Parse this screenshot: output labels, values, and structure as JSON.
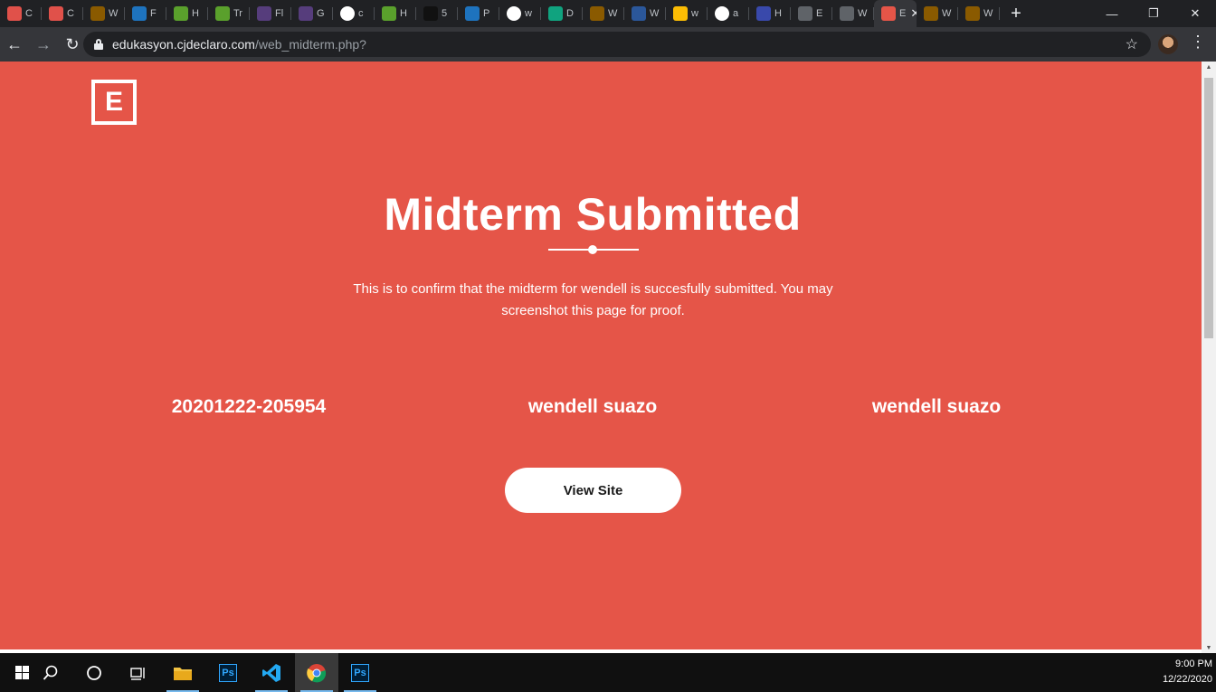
{
  "browser": {
    "tabs": [
      {
        "icon": "opera-tab-icon",
        "label": "C",
        "color": "#e0514a"
      },
      {
        "icon": "opera-tab-icon",
        "label": "C",
        "color": "#e0514a"
      },
      {
        "icon": "w-tab-icon",
        "label": "W",
        "color": "#8a5a00"
      },
      {
        "icon": "flag-tab-icon",
        "label": "F",
        "color": "#1e73be"
      },
      {
        "icon": "wave-tab-icon",
        "label": "H",
        "color": "#5aa02c"
      },
      {
        "icon": "wave-tab-icon",
        "label": "Tr",
        "color": "#5aa02c"
      },
      {
        "icon": "bootstrap-tab-icon",
        "label": "Fl",
        "color": "#563d7c"
      },
      {
        "icon": "bootstrap-tab-icon",
        "label": "G",
        "color": "#563d7c"
      },
      {
        "icon": "google-tab-icon",
        "label": "c",
        "color": "#ffffff"
      },
      {
        "icon": "wave-tab-icon",
        "label": "H",
        "color": "#5aa02c"
      },
      {
        "icon": "pixel-tab-icon",
        "label": "5",
        "color": "#111111"
      },
      {
        "icon": "flag-tab-icon",
        "label": "P",
        "color": "#1e73be"
      },
      {
        "icon": "github-tab-icon",
        "label": "w",
        "color": "#ffffff"
      },
      {
        "icon": "diamond-tab-icon",
        "label": "D",
        "color": "#10a37f"
      },
      {
        "icon": "w-tab-icon",
        "label": "W",
        "color": "#8a5a00"
      },
      {
        "icon": "word-tab-icon",
        "label": "W",
        "color": "#2b579a"
      },
      {
        "icon": "drive-tab-icon",
        "label": "w",
        "color": "#fbbc04"
      },
      {
        "icon": "google-tab-icon",
        "label": "a",
        "color": "#ffffff"
      },
      {
        "icon": "window-tab-icon",
        "label": "H",
        "color": "#3949ab"
      },
      {
        "icon": "globe-tab-icon",
        "label": "E",
        "color": "#5f6368"
      },
      {
        "icon": "contact-tab-icon",
        "label": "W",
        "color": "#5f6368"
      },
      {
        "icon": "edukasyon-tab-icon",
        "label": "E",
        "color": "#e55548",
        "active": true
      },
      {
        "icon": "w-tab-icon",
        "label": "W",
        "color": "#8a5a00"
      },
      {
        "icon": "w-tab-icon",
        "label": "W",
        "color": "#8a5a00"
      }
    ],
    "new_tab_glyph": "+",
    "url_host": "edukasyon.cjdeclaro.com",
    "url_path": "/web_midterm.php?"
  },
  "page": {
    "logo_letter": "E",
    "title": "Midterm Submitted",
    "message": "This is to confirm that the midterm for wendell is succesfully submitted. You may screenshot this page for proof.",
    "stats": [
      "20201222-205954",
      "wendell suazo",
      "wendell suazo"
    ],
    "cta_label": "View Site",
    "accent_color": "#e55548"
  },
  "taskbar": {
    "apps": [
      "start-icon",
      "search-icon",
      "cortana-icon",
      "task-view-icon",
      "file-explorer-icon",
      "photoshop-icon",
      "vscode-icon",
      "chrome-icon",
      "photoshop-icon"
    ],
    "time": "9:00 PM",
    "date": "12/22/2020"
  }
}
